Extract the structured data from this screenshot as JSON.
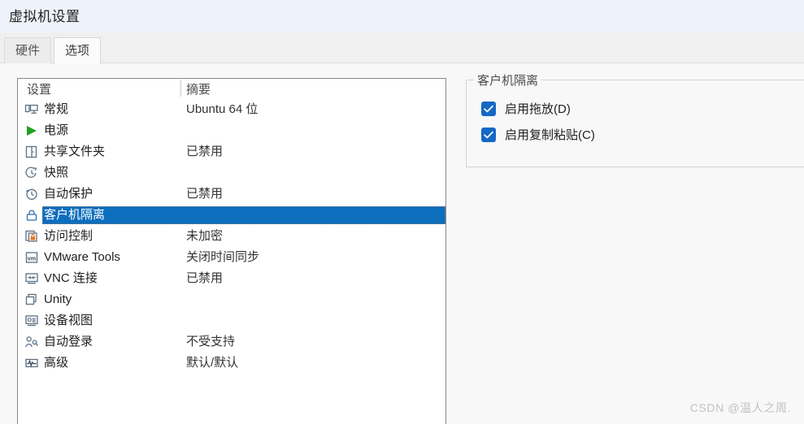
{
  "window": {
    "title": "虚拟机设置"
  },
  "tabs": [
    {
      "label": "硬件",
      "active": false,
      "name": "tab-hardware"
    },
    {
      "label": "选项",
      "active": true,
      "name": "tab-options"
    }
  ],
  "list": {
    "columns": {
      "settings": "设置",
      "summary": "摘要"
    },
    "rows": [
      {
        "icon": "monitor-icon",
        "label": "常规",
        "summary": "Ubuntu 64 位",
        "selected": false
      },
      {
        "icon": "play-triangle-icon",
        "label": "电源",
        "summary": "",
        "selected": false
      },
      {
        "icon": "shared-folder-icon",
        "label": "共享文件夹",
        "summary": "已禁用",
        "selected": false
      },
      {
        "icon": "snapshot-clock-icon",
        "label": "快照",
        "summary": "",
        "selected": false
      },
      {
        "icon": "autoprotect-clock-icon",
        "label": "自动保护",
        "summary": "已禁用",
        "selected": false
      },
      {
        "icon": "lock-icon",
        "label": "客户机隔离",
        "summary": "",
        "selected": true
      },
      {
        "icon": "access-control-icon",
        "label": "访问控制",
        "summary": "未加密",
        "selected": false
      },
      {
        "icon": "vmware-tools-icon",
        "label": "VMware Tools",
        "summary": "关闭时间同步",
        "selected": false
      },
      {
        "icon": "vnc-icon",
        "label": "VNC 连接",
        "summary": "已禁用",
        "selected": false
      },
      {
        "icon": "unity-icon",
        "label": "Unity",
        "summary": "",
        "selected": false
      },
      {
        "icon": "device-view-icon",
        "label": "设备视图",
        "summary": "",
        "selected": false
      },
      {
        "icon": "auto-login-icon",
        "label": "自动登录",
        "summary": "不受支持",
        "selected": false
      },
      {
        "icon": "advanced-wave-icon",
        "label": "高级",
        "summary": "默认/默认",
        "selected": false
      }
    ]
  },
  "options_panel": {
    "group_title": "客户机隔离",
    "checkboxes": [
      {
        "label": "启用拖放(D)",
        "checked": true,
        "name": "enable-drag-drop-checkbox"
      },
      {
        "label": "启用复制粘贴(C)",
        "checked": true,
        "name": "enable-copy-paste-checkbox"
      }
    ]
  },
  "watermark": {
    "text": "CSDN @温人之周."
  },
  "colors": {
    "selection_blue": "#0d6ebe",
    "checkbox_blue": "#1668c5",
    "titlebar_bg": "#eef2fb",
    "content_bg": "#f8f8f8",
    "icon_stroke": "#3f5c72",
    "play_green": "#1fa01f",
    "padlock_orange": "#e8761d"
  }
}
